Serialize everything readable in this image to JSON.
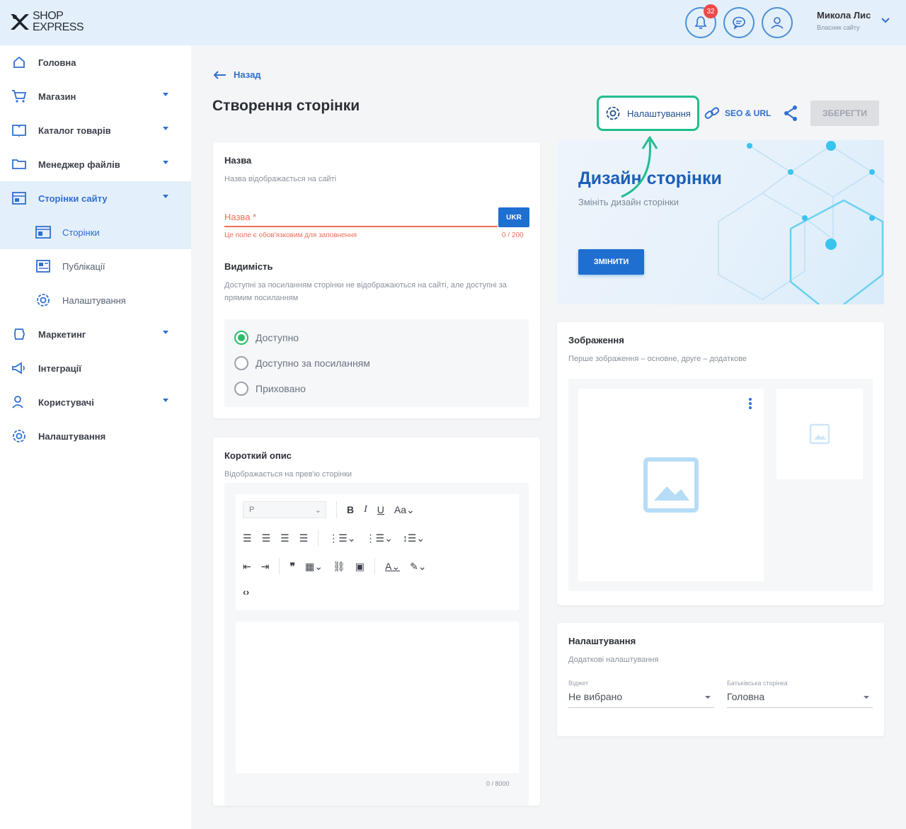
{
  "brand": {
    "line1": "SHOP",
    "line2": "EXPRESS"
  },
  "header": {
    "notifications_count": "32",
    "user_name": "Микола Лис",
    "user_role": "Власник сайту"
  },
  "sidebar": {
    "items": [
      {
        "label": "Головна"
      },
      {
        "label": "Магазин"
      },
      {
        "label": "Каталог товарів"
      },
      {
        "label": "Менеджер файлів"
      },
      {
        "label": "Сторінки сайту"
      },
      {
        "label": "Сторінки"
      },
      {
        "label": "Публікації"
      },
      {
        "label": "Налаштування"
      },
      {
        "label": "Маркетинг"
      },
      {
        "label": "Інтеграції"
      },
      {
        "label": "Користувачі"
      },
      {
        "label": "Налаштування"
      }
    ]
  },
  "page": {
    "back_label": "Назад",
    "title": "Створення сторінки",
    "settings_label": "Налаштування",
    "seo_label": "SEO & URL",
    "save_label": "ЗБЕРЕГТИ"
  },
  "name_card": {
    "title": "Назва",
    "subtitle": "Назва відображається на сайті",
    "placeholder": "Назва *",
    "lang_button": "UKR",
    "error": "Це поле є обов'язковим для заповнення",
    "counter": "0 / 200",
    "visibility_title": "Видимість",
    "visibility_subtitle": "Доступні за посиланням сторінки не відображаються на сайті, але доступні за прямим посиланням",
    "options": [
      "Доступно",
      "Доступно за посиланням",
      "Приховано"
    ]
  },
  "desc_card": {
    "title": "Короткий опис",
    "subtitle": "Відображається на прев'ю сторінки",
    "format_value": "P",
    "counter": "0 / 8000"
  },
  "design_card": {
    "title": "Дизайн сторінки",
    "subtitle": "Змініть дизайн сторінки",
    "button": "ЗМІНИТИ"
  },
  "images_card": {
    "title": "Зображення",
    "subtitle": "Перше зображення – основне, друге – додаткове"
  },
  "settings_card": {
    "title": "Налаштування",
    "subtitle": "Додаткові налаштування",
    "widget_label": "Віджет",
    "widget_value": "Не вибрано",
    "parent_label": "Батьківська сторінка",
    "parent_value": "Головна"
  },
  "colors": {
    "accent": "#1e6fd0",
    "highlight": "#1fbe8e",
    "error": "#ee6e5b",
    "success": "#2cbd6a"
  }
}
